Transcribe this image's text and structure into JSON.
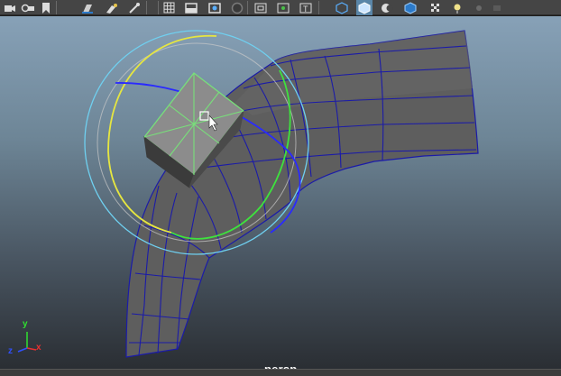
{
  "toolbar": {
    "icons": [
      "camera-select-icon",
      "camera-attributes-icon",
      "bookmark-icon",
      "image-plane-icon",
      "grease-pencil-icon",
      "pivot-icon",
      "grid-icon",
      "film-gate-icon",
      "resolution-gate-icon",
      "gate-mask-icon",
      "field-chart-icon",
      "safe-action-icon",
      "safe-title-icon",
      "wireframe-icon",
      "smooth-shade-icon",
      "shaded-wireframe-icon",
      "textured-icon",
      "lights-icon",
      "shadows-icon",
      "isolate-select-icon"
    ],
    "active_icon": "smooth-shade-icon"
  },
  "viewport": {
    "camera_label": "persp",
    "axes": {
      "x": "x",
      "y": "y",
      "z": "z"
    },
    "colors": {
      "mesh_face": "#5e5e5e",
      "mesh_edges": "#1b1ba8",
      "selected_face_edges": "#78e07a",
      "rotate_x_ring": "#2a2aff",
      "rotate_y_ring": "#3ee23e",
      "rotate_z_ring": "#e6e640",
      "rotate_view_ring": "#6fd0f0",
      "axis_x": "#e83030",
      "axis_y": "#30e030",
      "axis_z": "#3050ff"
    }
  }
}
